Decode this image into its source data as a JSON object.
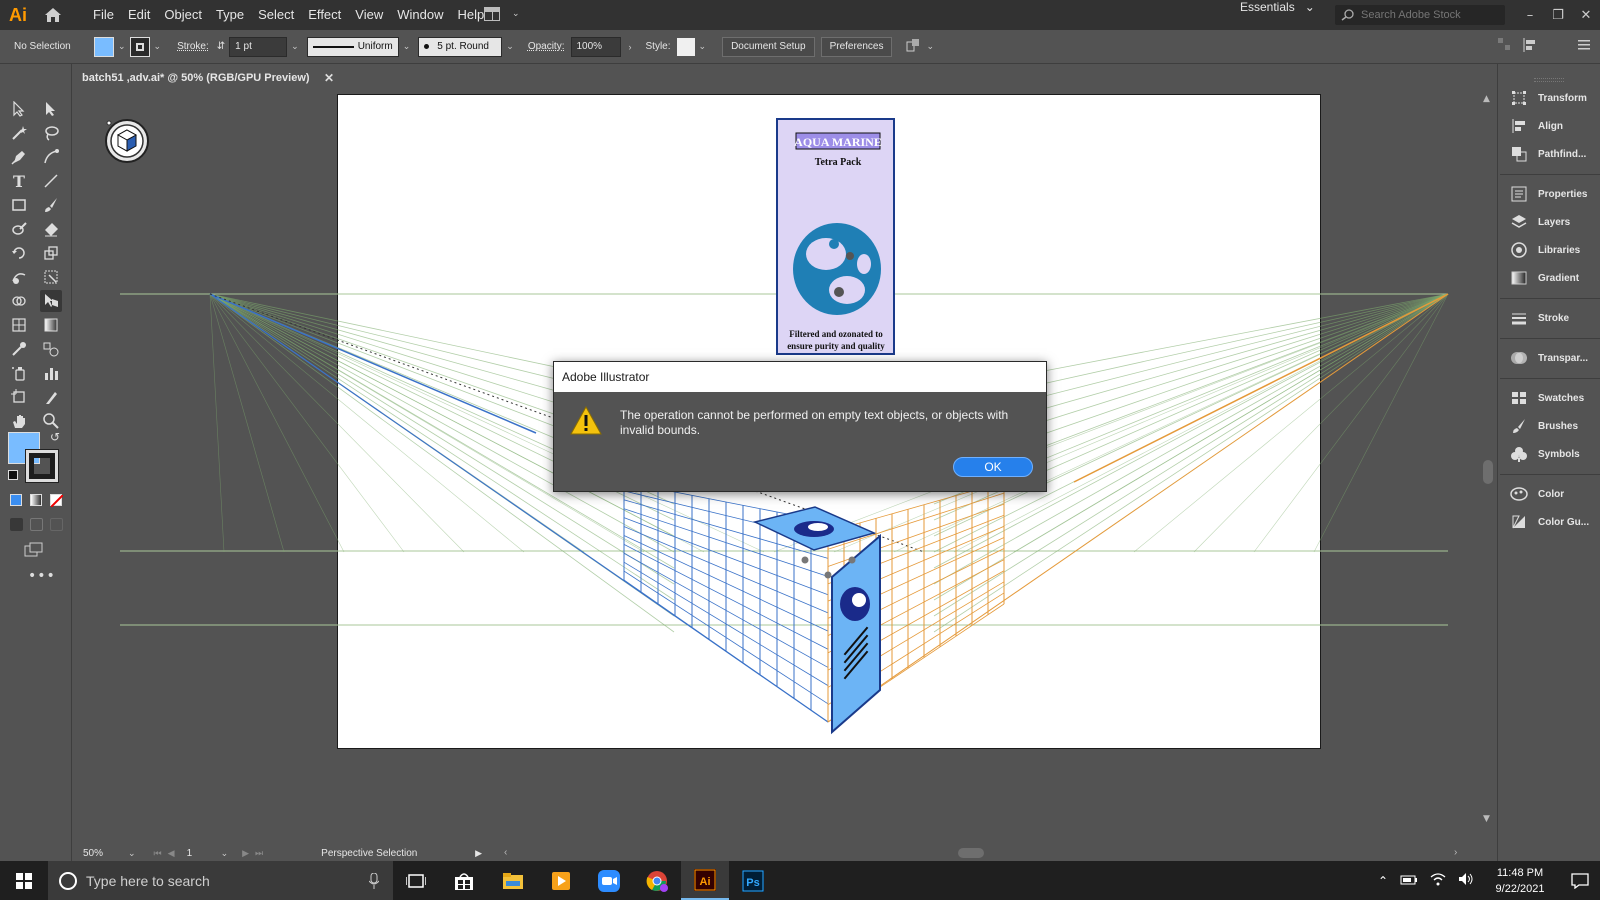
{
  "app": {
    "logo": "Ai",
    "accent": "#ff9a00"
  },
  "menu": [
    "File",
    "Edit",
    "Object",
    "Type",
    "Select",
    "Effect",
    "View",
    "Window",
    "Help"
  ],
  "workspace": "Essentials",
  "search": {
    "placeholder": "Search Adobe Stock"
  },
  "control_bar": {
    "selection": "No Selection",
    "stroke_label": "Stroke:",
    "stroke_value": "1 pt",
    "profile": "Uniform",
    "brush": "5 pt. Round",
    "opacity_label": "Opacity:",
    "opacity_value": "100%",
    "style_label": "Style:",
    "document_setup": "Document Setup",
    "preferences": "Preferences"
  },
  "document": {
    "tab_title": "batch51 ,adv.ai* @ 50% (RGB/GPU Preview)"
  },
  "artwork": {
    "title": "AQUA MARINE",
    "subtitle": "Tetra Pack",
    "tagline_1": "Filtered and ozonated to",
    "tagline_2": "ensure purity and quality",
    "box_color": "#ddd5f5",
    "side_color": "#6cb4f5"
  },
  "right_panel": [
    {
      "label": "Transform",
      "icon": "transform-icon"
    },
    {
      "label": "Align",
      "icon": "align-icon"
    },
    {
      "label": "Pathfind...",
      "icon": "pathfinder-icon"
    },
    {
      "label": "Properties",
      "icon": "properties-icon"
    },
    {
      "label": "Layers",
      "icon": "layers-icon"
    },
    {
      "label": "Libraries",
      "icon": "libraries-icon"
    },
    {
      "label": "Gradient",
      "icon": "gradient-icon"
    },
    {
      "label": "Stroke",
      "icon": "stroke-icon"
    },
    {
      "label": "Transpar...",
      "icon": "transparency-icon"
    },
    {
      "label": "Swatches",
      "icon": "swatches-icon"
    },
    {
      "label": "Brushes",
      "icon": "brushes-icon"
    },
    {
      "label": "Symbols",
      "icon": "symbols-icon"
    },
    {
      "label": "Color",
      "icon": "color-icon"
    },
    {
      "label": "Color Gu...",
      "icon": "color-guide-icon"
    }
  ],
  "status": {
    "zoom": "50%",
    "artboard": "1",
    "tool": "Perspective Selection"
  },
  "dialog": {
    "title": "Adobe Illustrator",
    "message": "The operation cannot be performed on empty text objects, or objects with invalid bounds.",
    "ok": "OK"
  },
  "taskbar": {
    "search_placeholder": "Type here to search",
    "time": "11:48 PM",
    "date": "9/22/2021",
    "apps": [
      "task-view-icon",
      "store-icon",
      "file-explorer-icon",
      "media-player-icon",
      "zoom-icon",
      "chrome-icon",
      "illustrator-icon",
      "photoshop-icon"
    ]
  }
}
